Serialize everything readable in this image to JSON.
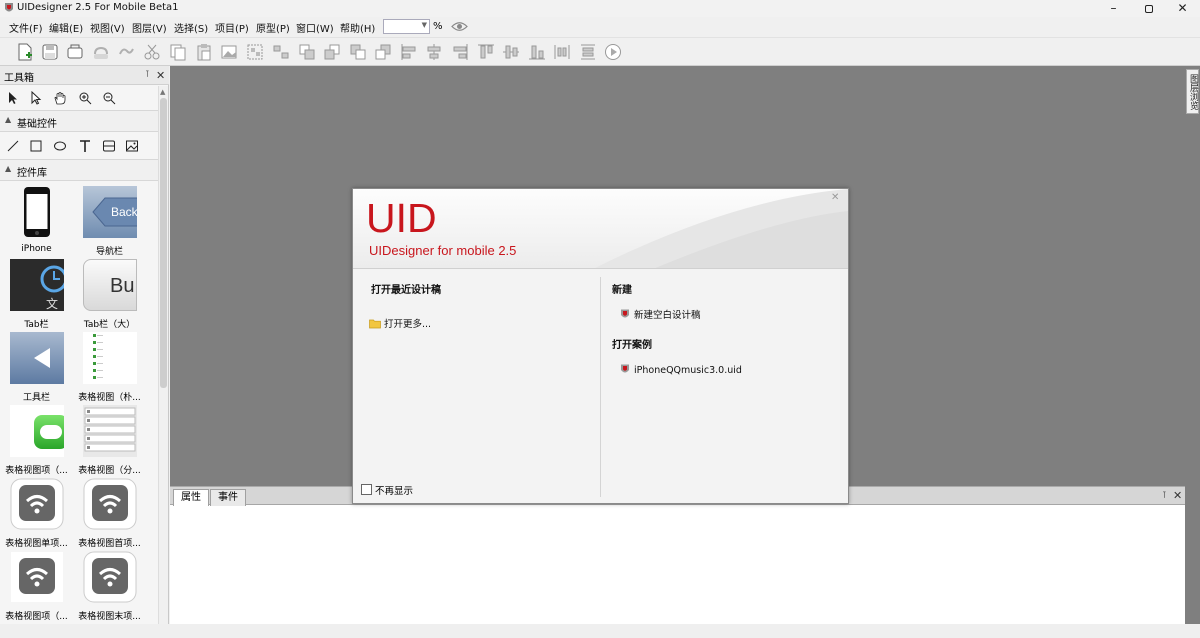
{
  "window": {
    "title": "UIDesigner 2.5 For Mobile Beta1"
  },
  "menu": [
    {
      "label": "文件(F)"
    },
    {
      "label": "编辑(E)"
    },
    {
      "label": "视图(V)"
    },
    {
      "label": "图层(V)"
    },
    {
      "label": "选择(S)"
    },
    {
      "label": "项目(P)"
    },
    {
      "label": "原型(P)"
    },
    {
      "label": "窗口(W)"
    },
    {
      "label": "帮助(H)"
    }
  ],
  "zoom": {
    "value": "",
    "unit": "%"
  },
  "toolbox": {
    "title": "工具箱",
    "sections": {
      "basic": "基础控件",
      "library": "控件库"
    },
    "controls": [
      {
        "label": "iPhone"
      },
      {
        "label": "导航栏"
      },
      {
        "label": "Tab栏"
      },
      {
        "label": "Tab栏（大）"
      },
      {
        "label": "工具栏"
      },
      {
        "label": "表格视图（朴..."
      },
      {
        "label": "表格视图项（..."
      },
      {
        "label": "表格视图（分..."
      },
      {
        "label": "表格视图单项..."
      },
      {
        "label": "表格视图首项..."
      },
      {
        "label": "表格视图项（..."
      },
      {
        "label": "表格视图末项..."
      }
    ],
    "thumb_text": {
      "back": "Back",
      "bu": "Bu",
      "wen": "文"
    }
  },
  "right_tab": {
    "label": "图层浏览"
  },
  "props": {
    "tabs": [
      {
        "label": "属性"
      },
      {
        "label": "事件"
      }
    ]
  },
  "dialog": {
    "logo": "UID",
    "subtitle": "UIDesigner for mobile 2.5",
    "recent_title": "打开最近设计稿",
    "open_more": "打开更多...",
    "new_title": "新建",
    "new_blank": "新建空白设计稿",
    "examples_title": "打开案例",
    "example_file": "iPhoneQQmusic3.0.uid",
    "dont_show": "不再显示"
  },
  "colors": {
    "brand": "#c8161d",
    "canvas": "#7f7f7f"
  }
}
